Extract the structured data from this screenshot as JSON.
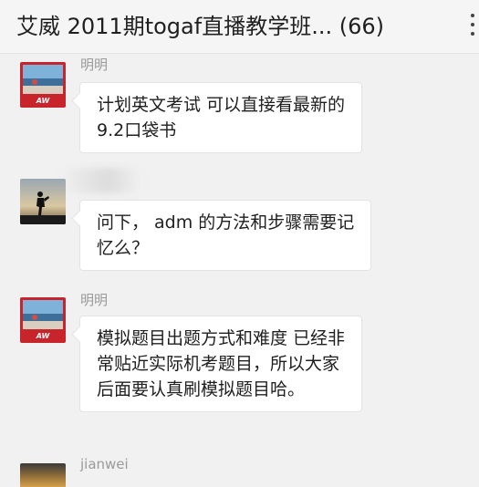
{
  "header": {
    "title": "艾威 2011期togaf直播教学班... (66)"
  },
  "messages": [
    {
      "sender": "明明",
      "avatar_icon": "aw-training-logo-avatar",
      "avatar_text": "艾威培训",
      "text": "计划英文考试 可以直接看最新的9.2口袋书"
    },
    {
      "sender": "",
      "avatar_icon": "hiker-silhouette-avatar",
      "text": "问下， adm 的方法和步骤需要记忆么？"
    },
    {
      "sender": "明明",
      "avatar_icon": "aw-training-logo-avatar",
      "avatar_text": "艾威培训",
      "text": "模拟题目出题方式和难度 已经非常贴近实际机考题目，所以大家后面要认真刷模拟题目哈。"
    },
    {
      "sender": "jianwei",
      "avatar_icon": "sunset-avatar"
    }
  ],
  "colors": {
    "background": "#f1f1f1",
    "header_bg": "#f5f5f5",
    "bubble_bg": "#ffffff",
    "sender_text": "#9a9a9a",
    "logo_red": "#c8242b"
  }
}
